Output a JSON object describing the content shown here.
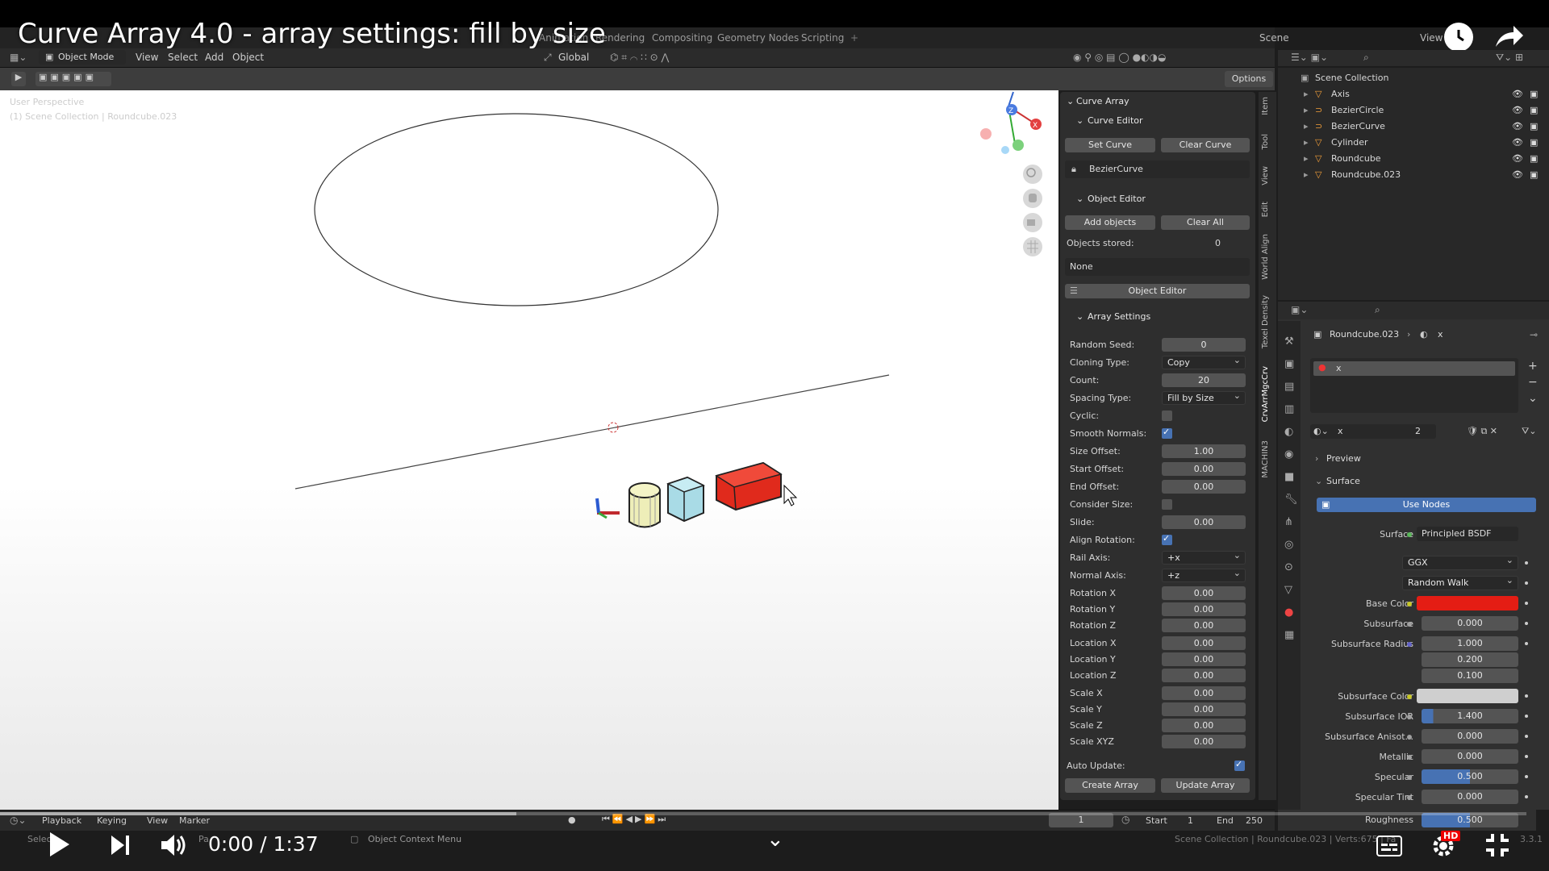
{
  "video": {
    "title": "Curve Array 4.0 - array settings: fill by size",
    "time": "0:00 / 1:37",
    "hd": "HD"
  },
  "topbar": {
    "tabs": [
      "Animation",
      "Rendering",
      "Compositing",
      "Geometry Nodes",
      "Scripting"
    ],
    "scene": "Scene",
    "view": "View"
  },
  "viewport_header": {
    "mode": "Object Mode",
    "menus": [
      "View",
      "Select",
      "Add",
      "Object"
    ],
    "orientation": "Global",
    "options": "Options"
  },
  "viewport": {
    "view_name": "User Perspective",
    "collection_info": "(1) Scene Collection | Roundcube.023"
  },
  "npanel": {
    "title": "Curve Array",
    "curve_editor": {
      "header": "Curve Editor",
      "set_curve": "Set Curve",
      "clear_curve": "Clear Curve",
      "curve_name": "BezierCurve"
    },
    "object_editor": {
      "header": "Object Editor",
      "add_objects": "Add objects",
      "clear_all": "Clear All",
      "objects_stored_label": "Objects stored:",
      "objects_stored_value": "0",
      "none": "None",
      "object_editor_btn": "Object Editor"
    },
    "array_settings": {
      "header": "Array Settings",
      "random_seed": {
        "label": "Random Seed:",
        "value": "0"
      },
      "cloning_type": {
        "label": "Cloning Type:",
        "value": "Copy"
      },
      "count": {
        "label": "Count:",
        "value": "20"
      },
      "spacing_type": {
        "label": "Spacing Type:",
        "value": "Fill by Size"
      },
      "cyclic": {
        "label": "Cyclic:",
        "checked": false
      },
      "smooth_normals": {
        "label": "Smooth Normals:",
        "checked": true
      },
      "size_offset": {
        "label": "Size Offset:",
        "value": "1.00"
      },
      "start_offset": {
        "label": "Start Offset:",
        "value": "0.00"
      },
      "end_offset": {
        "label": "End Offset:",
        "value": "0.00"
      },
      "consider_size": {
        "label": "Consider Size:",
        "checked": false
      },
      "slide": {
        "label": "Slide:",
        "value": "0.00"
      },
      "align_rotation": {
        "label": "Align Rotation:",
        "checked": true
      },
      "rail_axis": {
        "label": "Rail Axis:",
        "value": "+x"
      },
      "normal_axis": {
        "label": "Normal Axis:",
        "value": "+z"
      },
      "rotation_x": {
        "label": "Rotation X",
        "value": "0.00"
      },
      "rotation_y": {
        "label": "Rotation Y",
        "value": "0.00"
      },
      "rotation_z": {
        "label": "Rotation Z",
        "value": "0.00"
      },
      "location_x": {
        "label": "Location X",
        "value": "0.00"
      },
      "location_y": {
        "label": "Location Y",
        "value": "0.00"
      },
      "location_z": {
        "label": "Location Z",
        "value": "0.00"
      },
      "scale_x": {
        "label": "Scale X",
        "value": "0.00"
      },
      "scale_y": {
        "label": "Scale Y",
        "value": "0.00"
      },
      "scale_z": {
        "label": "Scale Z",
        "value": "0.00"
      },
      "scale_xyz": {
        "label": "Scale XYZ",
        "value": "0.00"
      }
    },
    "auto_update": {
      "label": "Auto Update:",
      "checked": true
    },
    "create_array": "Create Array",
    "update_array": "Update Array",
    "tabs": [
      "Item",
      "Tool",
      "View",
      "Edit",
      "World Align",
      "Texel Density",
      "CrvArrMgcCrv",
      "MACHIN3"
    ]
  },
  "outliner": {
    "root": "Scene Collection",
    "items": [
      {
        "name": "Axis"
      },
      {
        "name": "BezierCircle"
      },
      {
        "name": "BezierCurve"
      },
      {
        "name": "Cylinder"
      },
      {
        "name": "Roundcube"
      },
      {
        "name": "Roundcube.023"
      }
    ]
  },
  "properties": {
    "breadcrumb_object": "Roundcube.023",
    "breadcrumb_material": "x",
    "slot_name": "x",
    "material_name": "x",
    "users": "2",
    "preview": "Preview",
    "surface_section": "Surface",
    "use_nodes": "Use Nodes",
    "surface_label": "Surface",
    "surface_value": "Principled BSDF",
    "distribution": "GGX",
    "subsurface_method": "Random Walk",
    "base_color_label": "Base Color",
    "base_color": "#e41d14",
    "subsurface": {
      "label": "Subsurface",
      "value": "0.000"
    },
    "subsurface_radius": {
      "label": "Subsurface Radius",
      "values": [
        "1.000",
        "0.200",
        "0.100"
      ]
    },
    "subsurface_color_label": "Subsurface Color",
    "subsurface_color": "#cfcfcf",
    "subsurface_ior": {
      "label": "Subsurface IOR",
      "value": "1.400"
    },
    "subsurface_aniso": {
      "label": "Subsurface Anisot...",
      "value": "0.000"
    },
    "metallic": {
      "label": "Metallic",
      "value": "0.000"
    },
    "specular": {
      "label": "Specular",
      "value": "0.500"
    },
    "specular_tint": {
      "label": "Specular Tint",
      "value": "0.000"
    },
    "roughness": {
      "label": "Roughness",
      "value": "0.500"
    }
  },
  "timeline": {
    "menus": [
      "Playback",
      "Keying",
      "View",
      "Marker"
    ],
    "current_frame": "1",
    "start_label": "Start",
    "start": "1",
    "end_label": "End",
    "end": "250"
  },
  "statusbar": {
    "select": "Selec",
    "pan": "Pa",
    "context_menu": "Object Context Menu",
    "info": "Scene Collection | Roundcube.023 | Verts:675 | Fa",
    "version": "3.3.1"
  },
  "colors": {
    "accent": "#4772b3",
    "red_cube": "#e02a1c",
    "blue_cube": "#a9dbe6",
    "cylinder": "#eeeeb8"
  }
}
